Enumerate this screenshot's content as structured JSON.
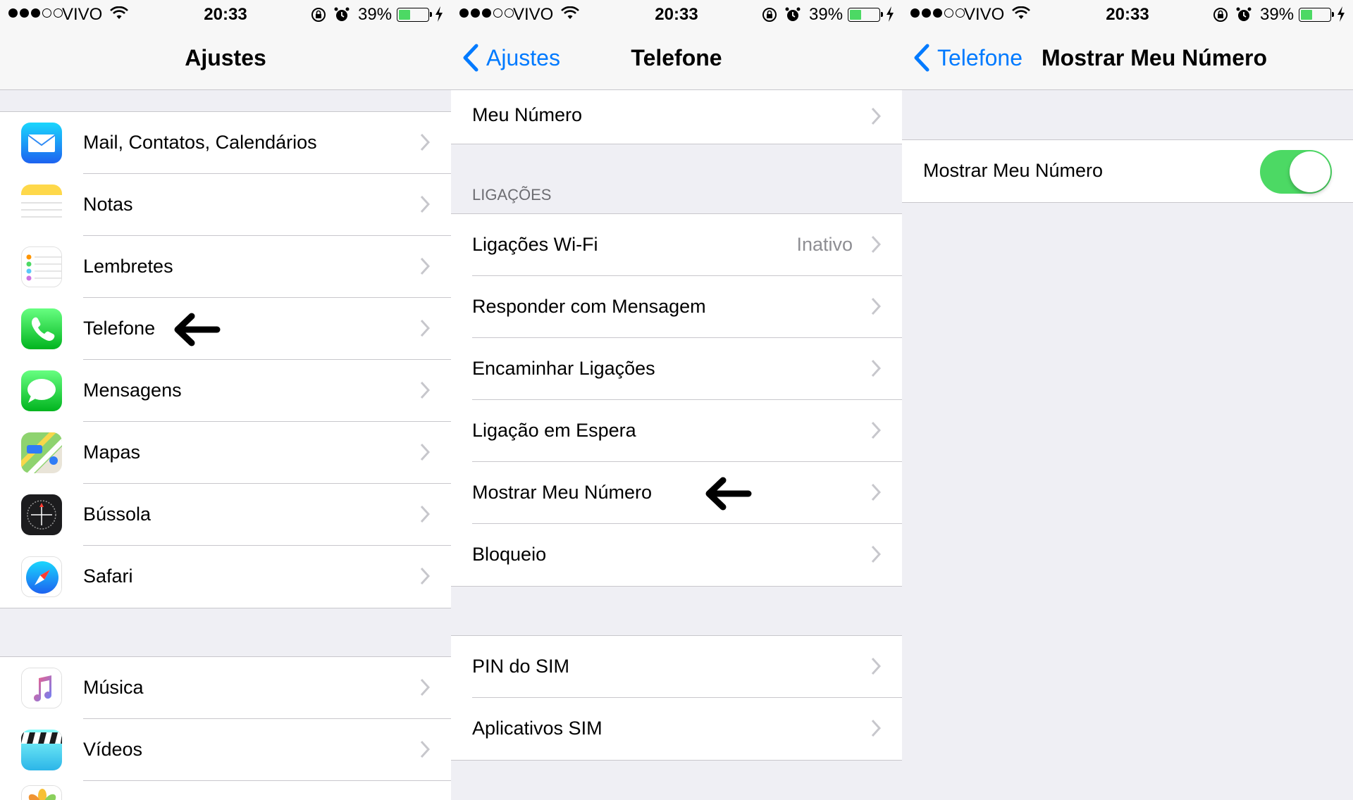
{
  "status_bar": {
    "carrier": "VIVO",
    "time": "20:33",
    "battery_percent": "39%",
    "battery_level": 0.39
  },
  "panel1": {
    "title": "Ajustes",
    "group1": [
      {
        "label": "Mail, Contatos, Calendários",
        "icon": "mail-icon"
      },
      {
        "label": "Notas",
        "icon": "notes-icon"
      },
      {
        "label": "Lembretes",
        "icon": "reminders-icon"
      },
      {
        "label": "Telefone",
        "icon": "phone-icon"
      },
      {
        "label": "Mensagens",
        "icon": "messages-icon"
      },
      {
        "label": "Mapas",
        "icon": "maps-icon"
      },
      {
        "label": "Bússola",
        "icon": "compass-icon"
      },
      {
        "label": "Safari",
        "icon": "safari-icon"
      }
    ],
    "group2": [
      {
        "label": "Música",
        "icon": "music-icon"
      },
      {
        "label": "Vídeos",
        "icon": "videos-icon"
      }
    ]
  },
  "panel2": {
    "back_label": "Ajustes",
    "title": "Telefone",
    "my_number": "Meu Número",
    "section_header": "LIGAÇÕES",
    "calls_group": [
      {
        "label": "Ligações Wi-Fi",
        "detail": "Inativo"
      },
      {
        "label": "Responder com Mensagem"
      },
      {
        "label": "Encaminhar Ligações"
      },
      {
        "label": "Ligação em Espera"
      },
      {
        "label": "Mostrar Meu Número"
      },
      {
        "label": "Bloqueio"
      }
    ],
    "sim_group": [
      {
        "label": "PIN do SIM"
      },
      {
        "label": "Aplicativos SIM"
      }
    ]
  },
  "panel3": {
    "back_label": "Telefone",
    "title": "Mostrar Meu Número",
    "toggle_label": "Mostrar Meu Número",
    "toggle_on": true
  },
  "colors": {
    "accent": "#007aff",
    "toggle_on": "#4cd964",
    "background": "#efeff4"
  }
}
